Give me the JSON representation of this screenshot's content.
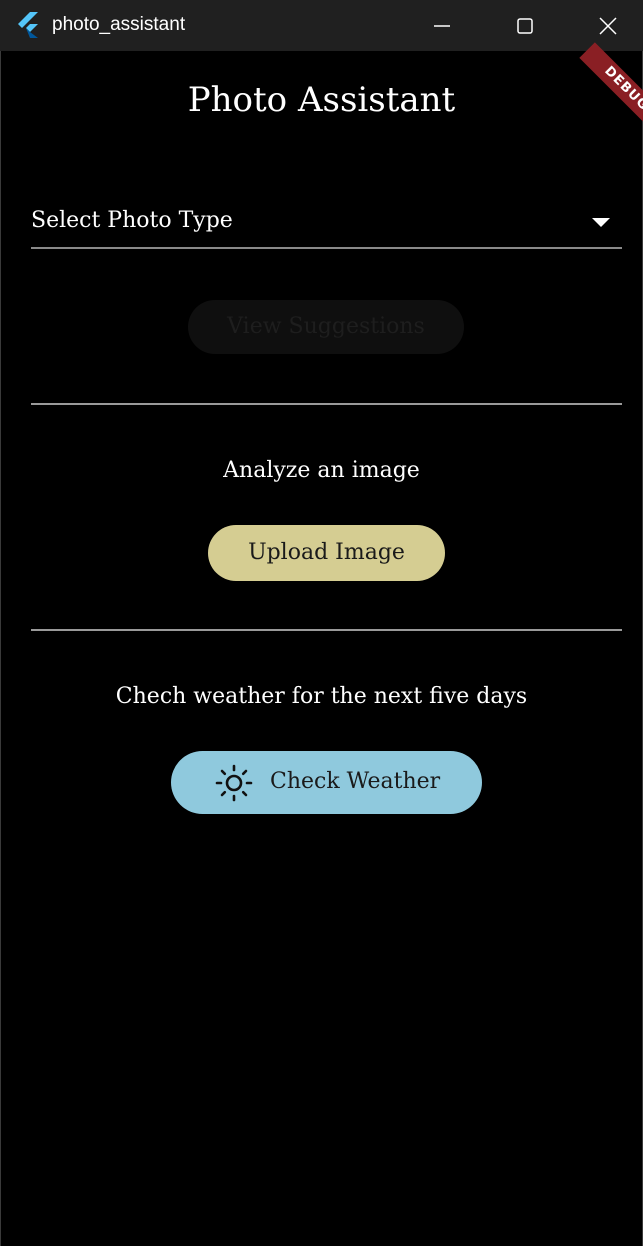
{
  "window": {
    "title": "photo_assistant",
    "minimize_icon": "minimize-icon",
    "maximize_icon": "maximize-icon",
    "close_icon": "close-icon"
  },
  "debug_banner": "DEBUG",
  "page": {
    "title": "Photo Assistant"
  },
  "photo_type_dropdown": {
    "placeholder": "Select Photo Type",
    "icon": "dropdown-arrow-icon"
  },
  "view_suggestions": {
    "label": "View Suggestions",
    "enabled": false
  },
  "analyze_section": {
    "label": "Analyze an image",
    "button_label": "Upload Image",
    "button_color": "#d5cd92"
  },
  "weather_section": {
    "label": "Chech weather for the next five days",
    "button_label": "Check Weather",
    "button_icon": "sun-icon",
    "button_color": "#8fc9dd"
  },
  "colors": {
    "background": "#000000",
    "titlebar": "#202020",
    "debug_banner": "#8a1f24"
  }
}
